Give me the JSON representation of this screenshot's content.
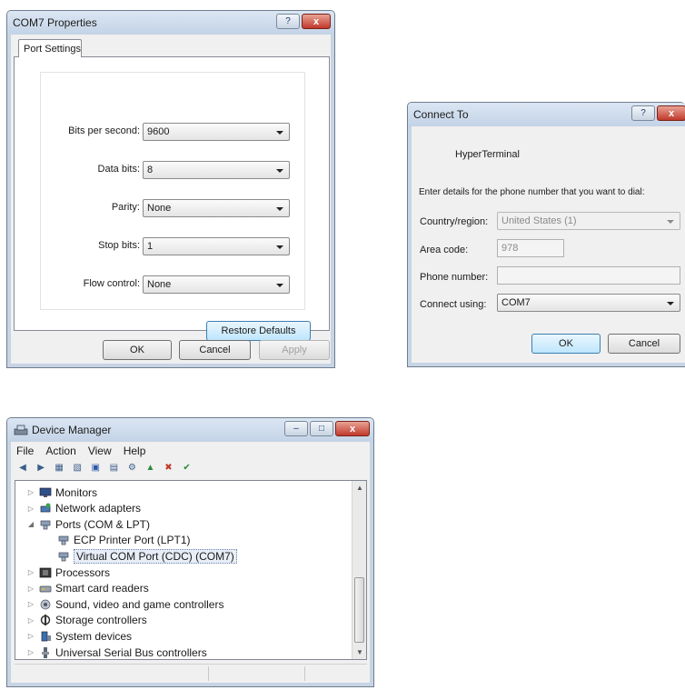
{
  "com7_properties": {
    "title": "COM7 Properties",
    "help_label": "?",
    "close_label": "x",
    "tab_label": "Port Settings",
    "fields": [
      {
        "label": "Bits per second:",
        "value": "9600"
      },
      {
        "label": "Data bits:",
        "value": "8"
      },
      {
        "label": "Parity:",
        "value": "None"
      },
      {
        "label": "Stop bits:",
        "value": "1"
      },
      {
        "label": "Flow control:",
        "value": "None"
      }
    ],
    "restore_label": "Restore Defaults",
    "ok_label": "OK",
    "cancel_label": "Cancel",
    "apply_label": "Apply"
  },
  "connect_to": {
    "title": "Connect To",
    "help_label": "?",
    "close_label": "x",
    "connection_name": "HyperTerminal",
    "instruction": "Enter details for the phone number that you want to dial:",
    "country_label": "Country/region:",
    "country_value": "United States (1)",
    "area_label": "Area code:",
    "area_value": "978",
    "phone_label": "Phone number:",
    "phone_value": "",
    "connect_using_label": "Connect using:",
    "connect_using_value": "COM7",
    "ok_label": "OK",
    "cancel_label": "Cancel"
  },
  "device_manager": {
    "title": "Device Manager",
    "minimize_label": "–",
    "maximize_label": "□",
    "close_label": "x",
    "menu": [
      "File",
      "Action",
      "View",
      "Help"
    ],
    "tree": [
      {
        "label": "Monitors",
        "icon": "monitor-icon",
        "expanded": false,
        "level": 0
      },
      {
        "label": "Network adapters",
        "icon": "network-icon",
        "expanded": false,
        "level": 0
      },
      {
        "label": "Ports (COM & LPT)",
        "icon": "port-icon",
        "expanded": true,
        "level": 0
      },
      {
        "label": "ECP Printer Port (LPT1)",
        "icon": "port-icon",
        "level": 1
      },
      {
        "label": "Virtual COM Port (CDC) (COM7)",
        "icon": "port-icon",
        "level": 1,
        "selected": true
      },
      {
        "label": "Processors",
        "icon": "processor-icon",
        "expanded": false,
        "level": 0
      },
      {
        "label": "Smart card readers",
        "icon": "smartcard-icon",
        "expanded": false,
        "level": 0
      },
      {
        "label": "Sound, video and game controllers",
        "icon": "sound-icon",
        "expanded": false,
        "level": 0
      },
      {
        "label": "Storage controllers",
        "icon": "storage-icon",
        "expanded": false,
        "level": 0
      },
      {
        "label": "System devices",
        "icon": "system-icon",
        "expanded": false,
        "level": 0
      },
      {
        "label": "Universal Serial Bus controllers",
        "icon": "usb-icon",
        "expanded": false,
        "level": 0
      }
    ]
  }
}
